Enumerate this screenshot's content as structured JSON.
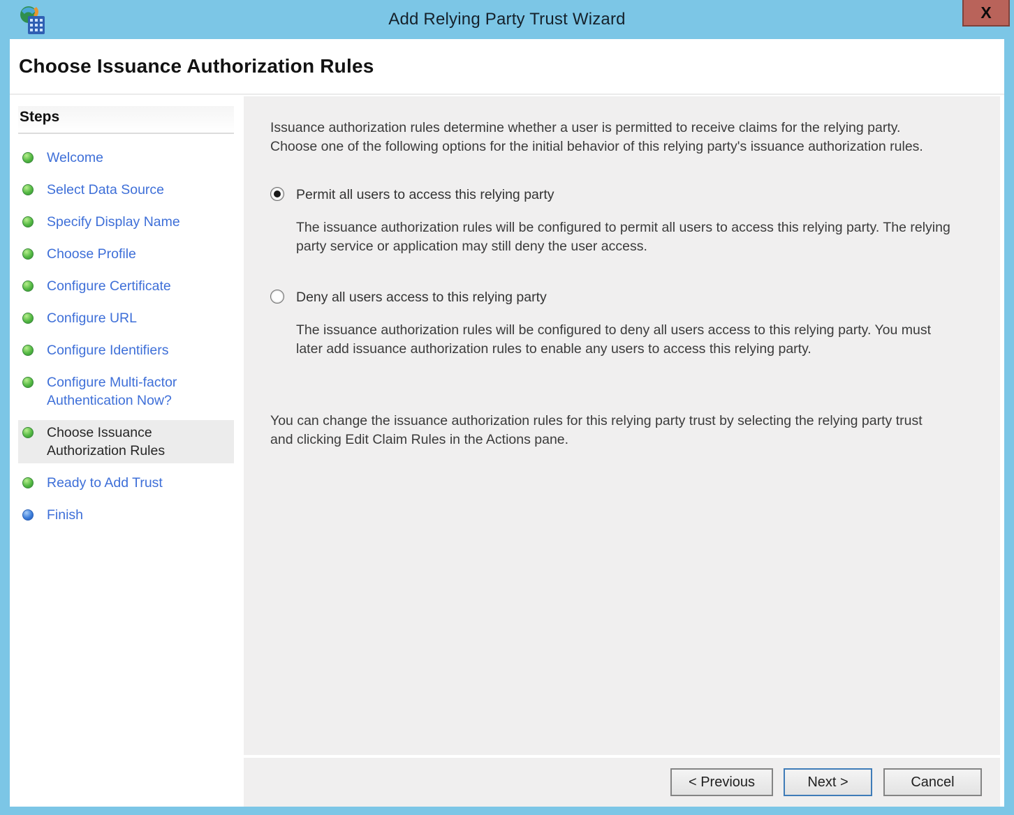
{
  "window": {
    "title": "Add Relying Party Trust Wizard",
    "close_label": "X"
  },
  "page": {
    "heading": "Choose Issuance Authorization Rules"
  },
  "sidebar": {
    "heading": "Steps",
    "items": [
      {
        "label": "Welcome",
        "bullet": "green",
        "current": false
      },
      {
        "label": "Select Data Source",
        "bullet": "green",
        "current": false
      },
      {
        "label": "Specify Display Name",
        "bullet": "green",
        "current": false
      },
      {
        "label": "Choose Profile",
        "bullet": "green",
        "current": false
      },
      {
        "label": "Configure Certificate",
        "bullet": "green",
        "current": false
      },
      {
        "label": "Configure URL",
        "bullet": "green",
        "current": false
      },
      {
        "label": "Configure Identifiers",
        "bullet": "green",
        "current": false
      },
      {
        "label": "Configure Multi-factor Authentication Now?",
        "bullet": "green",
        "current": false
      },
      {
        "label": "Choose Issuance Authorization Rules",
        "bullet": "green",
        "current": true
      },
      {
        "label": "Ready to Add Trust",
        "bullet": "green",
        "current": false
      },
      {
        "label": "Finish",
        "bullet": "blue",
        "current": false
      }
    ]
  },
  "main": {
    "intro": [
      "Issuance authorization rules determine whether a user is permitted to receive claims for the relying party.",
      "Choose one of the following options for the initial behavior of this relying party's issuance authorization rules."
    ],
    "options": [
      {
        "label": "Permit all users to access this relying party",
        "selected": true,
        "description": [
          "The issuance authorization rules will be configured to permit all users to access this relying party. The relying",
          "party service or application may still deny the user access."
        ]
      },
      {
        "label": "Deny all users access to this relying party",
        "selected": false,
        "description": [
          "The issuance authorization rules will be configured to deny all users access to this relying party. You must",
          "later add issuance authorization rules to enable any users to access this relying party."
        ]
      }
    ],
    "note": [
      "You can change the issuance authorization rules for this relying party trust by selecting the relying party trust",
      "and clicking Edit Claim Rules in the Actions pane."
    ]
  },
  "footer": {
    "previous_label": "< Previous",
    "next_label": "Next >",
    "cancel_label": "Cancel"
  },
  "colors": {
    "titlebar_blue": "#7cc6e6",
    "close_button_red": "#b9635a",
    "link_blue": "#3e6fd8",
    "step_done_green": "#55b944",
    "step_final_blue": "#3d7edb",
    "main_gray": "#f0efef",
    "next_button_border": "#3f7cb8"
  }
}
